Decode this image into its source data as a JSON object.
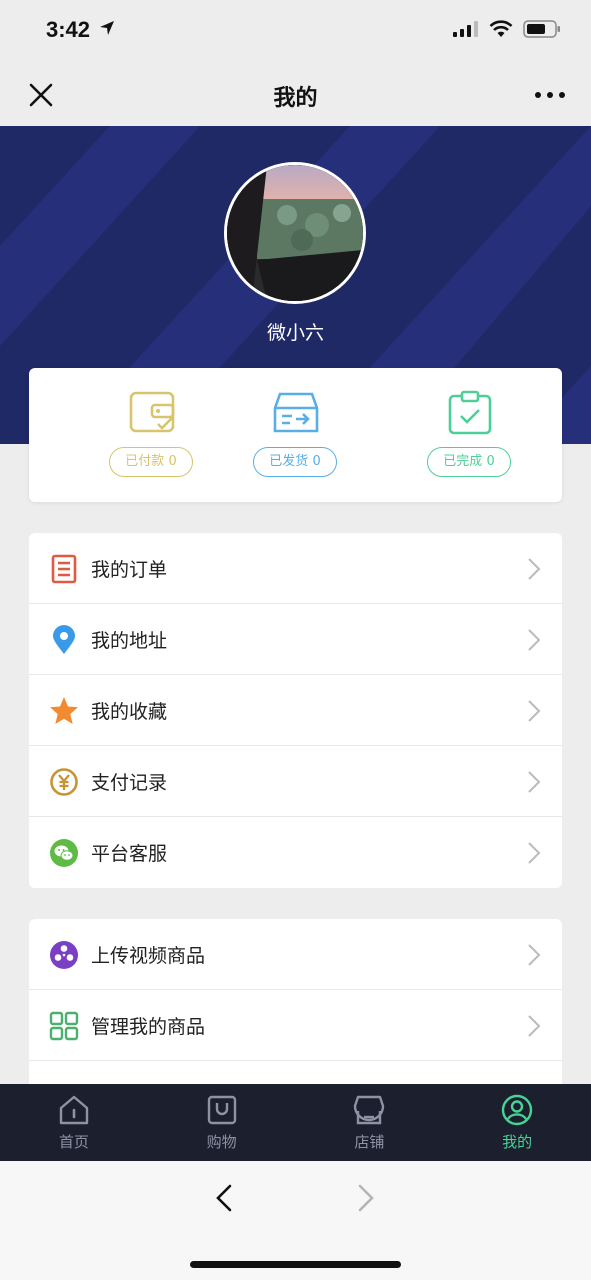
{
  "status": {
    "time": "3:42"
  },
  "nav": {
    "title": "我的",
    "close_icon": "close-icon",
    "more_icon": "more-icon"
  },
  "profile": {
    "username": "微小六"
  },
  "orders": [
    {
      "label": "已付款",
      "count": "0",
      "icon": "wallet-check-icon",
      "color": "#d8c46c"
    },
    {
      "label": "已发货",
      "count": "0",
      "icon": "box-arrow-icon",
      "color": "#5aaee6"
    },
    {
      "label": "已完成",
      "count": "0",
      "icon": "clipboard-check-icon",
      "color": "#4fcf98"
    }
  ],
  "menu_primary": [
    {
      "label": "我的订单",
      "icon": "order-list-icon"
    },
    {
      "label": "我的地址",
      "icon": "location-pin-icon"
    },
    {
      "label": "我的收藏",
      "icon": "star-icon"
    },
    {
      "label": "支付记录",
      "icon": "yuan-coin-icon"
    },
    {
      "label": "平台客服",
      "icon": "wechat-icon"
    }
  ],
  "menu_secondary": [
    {
      "label": "上传视频商品",
      "icon": "film-reel-icon"
    },
    {
      "label": "管理我的商品",
      "icon": "grid-icon"
    }
  ],
  "tabs": [
    {
      "label": "首页",
      "icon": "home-icon"
    },
    {
      "label": "购物",
      "icon": "shopping-bag-icon"
    },
    {
      "label": "店铺",
      "icon": "store-icon"
    },
    {
      "label": "我的",
      "icon": "user-circle-icon"
    }
  ],
  "colors": {
    "hero_bg": "#1f2966",
    "tab_active": "#46d394",
    "tabbar_bg": "#1c1f2e"
  }
}
